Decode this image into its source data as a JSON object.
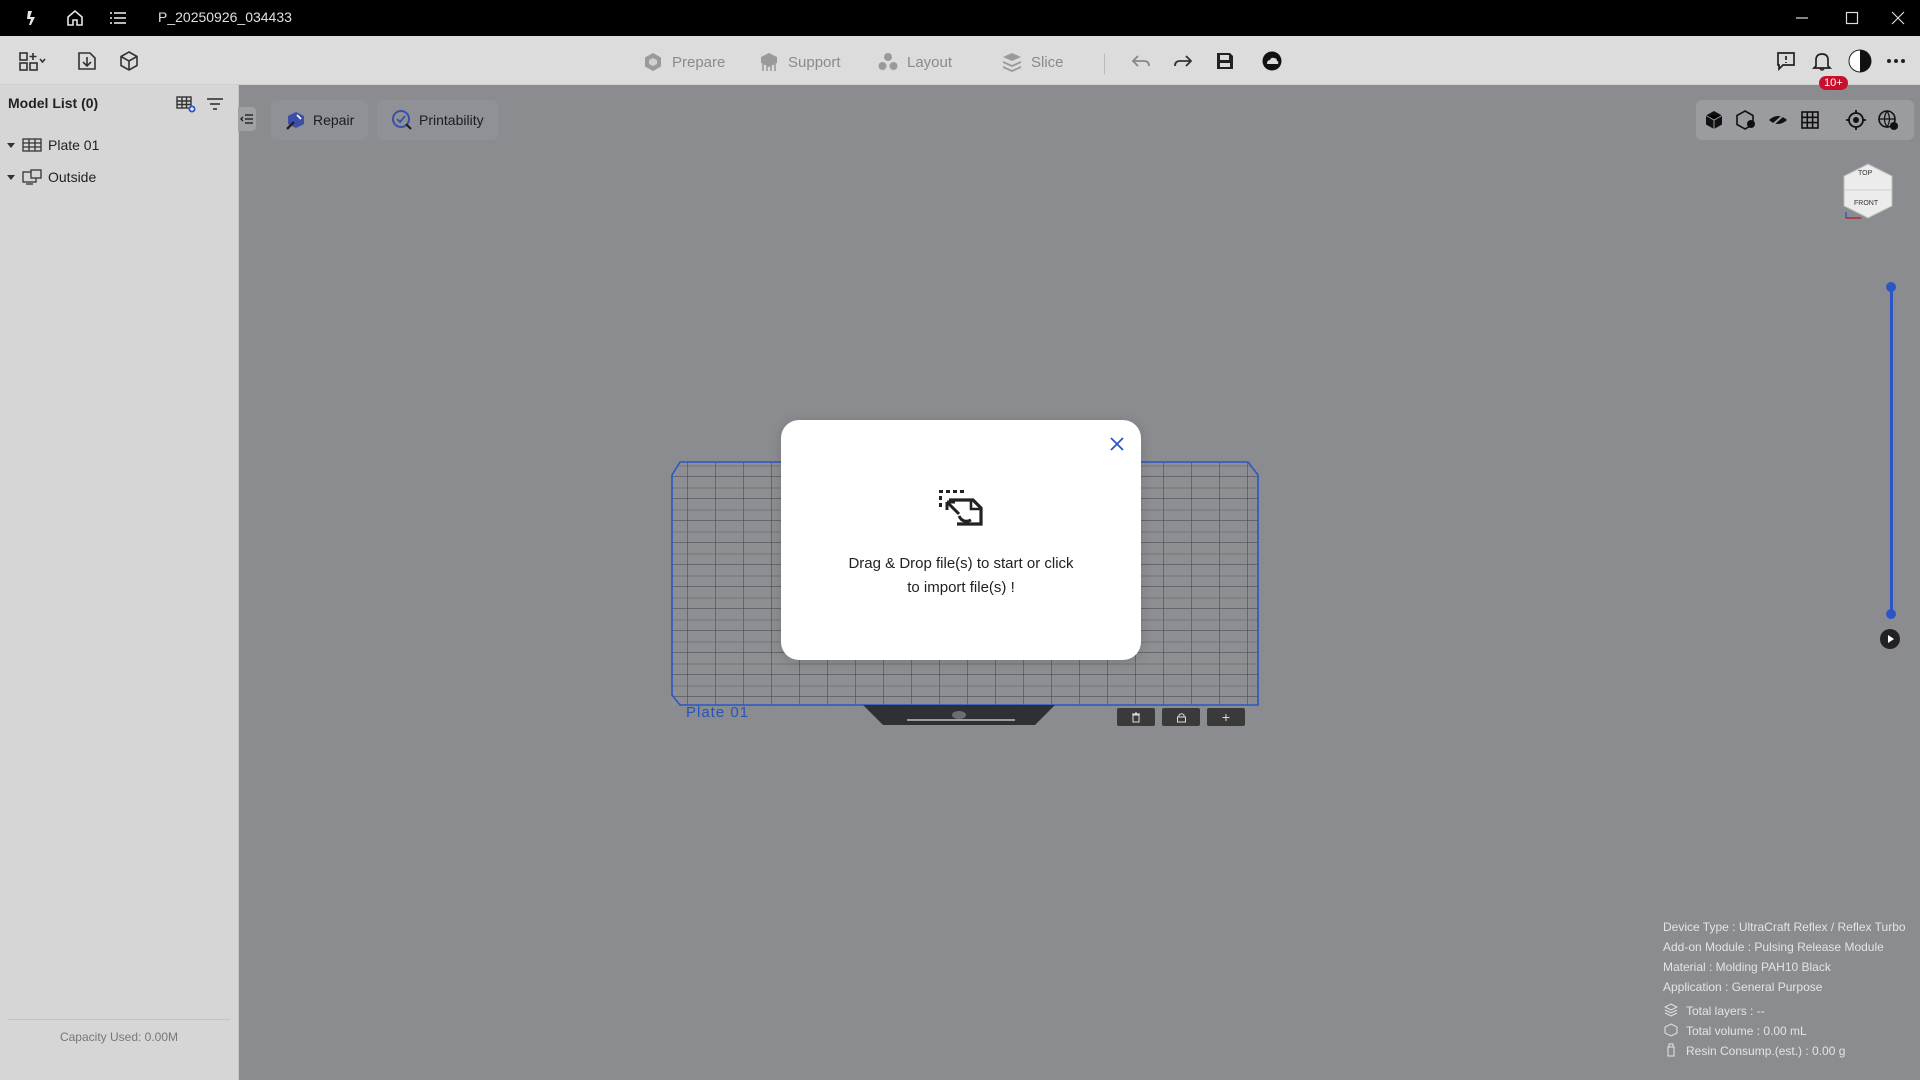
{
  "window": {
    "title": "P_20250926_034433"
  },
  "toolbar": {
    "modes": [
      {
        "label": "Prepare",
        "icon": "prepare-icon"
      },
      {
        "label": "Support",
        "icon": "support-icon"
      },
      {
        "label": "Layout",
        "icon": "layout-icon"
      },
      {
        "label": "Slice",
        "icon": "slice-icon"
      }
    ],
    "notifications_badge": "10+"
  },
  "sidebar": {
    "title": "Model List (0)",
    "items": [
      {
        "label": "Plate 01"
      },
      {
        "label": "Outside"
      }
    ],
    "capacity": "Capacity Used: 0.00M"
  },
  "viewport_buttons": {
    "repair": "Repair",
    "printability": "Printability"
  },
  "plate": {
    "label": "Plate 01",
    "add": "+"
  },
  "nav_cube": {
    "top": "TOP",
    "front": "FRONT"
  },
  "modal": {
    "line1": "Drag & Drop file(s) to start or click",
    "line2": "to import file(s) !"
  },
  "info": {
    "device_type": "Device Type : UltraCraft Reflex / Reflex Turbo",
    "addon": "Add-on Module : Pulsing Release Module",
    "material": "Material : Molding PAH10 Black",
    "application": "Application : General Purpose",
    "total_layers": "Total layers : --",
    "total_volume": "Total volume : 0.00 mL",
    "resin": "Resin Consump.(est.) : 0.00 g"
  },
  "colors": {
    "accent": "#2a56c6",
    "badge": "#c8102e",
    "plate_grid": "#3d3f45"
  }
}
